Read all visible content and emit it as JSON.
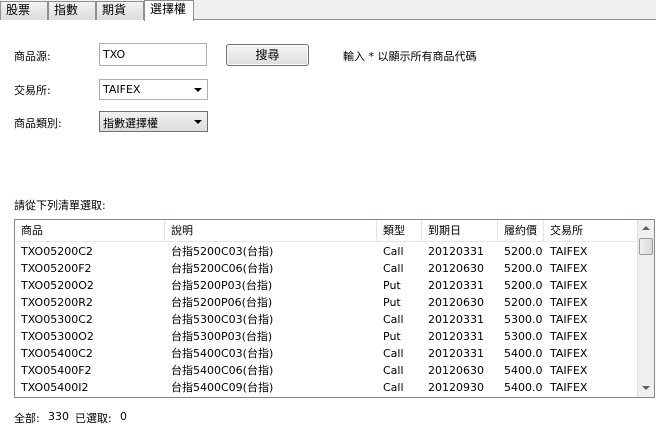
{
  "tabs": [
    {
      "label": "股票",
      "active": false
    },
    {
      "label": "指數",
      "active": false
    },
    {
      "label": "期貨",
      "active": false
    },
    {
      "label": "選擇權",
      "active": true
    }
  ],
  "form": {
    "source_label": "商品源:",
    "source_value": "TXO",
    "search_button": "搜尋",
    "hint": "輸入 * 以顯示所有商品代碼",
    "exchange_label": "交易所:",
    "exchange_value": "TAIFEX",
    "category_label": "商品類別:",
    "category_value": "指數選擇權"
  },
  "list": {
    "prompt": "請從下列清單選取:",
    "columns": [
      "商品",
      "說明",
      "類型",
      "到期日",
      "履約價",
      "交易所"
    ],
    "rows": [
      [
        "TXO05200C2",
        "台指5200C03(台指)",
        "Call",
        "20120331",
        "5200.0",
        "TAIFEX"
      ],
      [
        "TXO05200F2",
        "台指5200C06(台指)",
        "Call",
        "20120630",
        "5200.0",
        "TAIFEX"
      ],
      [
        "TXO05200O2",
        "台指5200P03(台指)",
        "Put",
        "20120331",
        "5200.0",
        "TAIFEX"
      ],
      [
        "TXO05200R2",
        "台指5200P06(台指)",
        "Put",
        "20120630",
        "5200.0",
        "TAIFEX"
      ],
      [
        "TXO05300C2",
        "台指5300C03(台指)",
        "Call",
        "20120331",
        "5300.0",
        "TAIFEX"
      ],
      [
        "TXO05300O2",
        "台指5300P03(台指)",
        "Put",
        "20120331",
        "5300.0",
        "TAIFEX"
      ],
      [
        "TXO05400C2",
        "台指5400C03(台指)",
        "Call",
        "20120331",
        "5400.0",
        "TAIFEX"
      ],
      [
        "TXO05400F2",
        "台指5400C06(台指)",
        "Call",
        "20120630",
        "5400.0",
        "TAIFEX"
      ],
      [
        "TXO05400I2",
        "台指5400C09(台指)",
        "Call",
        "20120930",
        "5400.0",
        "TAIFEX"
      ]
    ]
  },
  "status": {
    "total_label": "全部:",
    "total_value": "330",
    "selected_label": "已選取:",
    "selected_value": "0"
  }
}
